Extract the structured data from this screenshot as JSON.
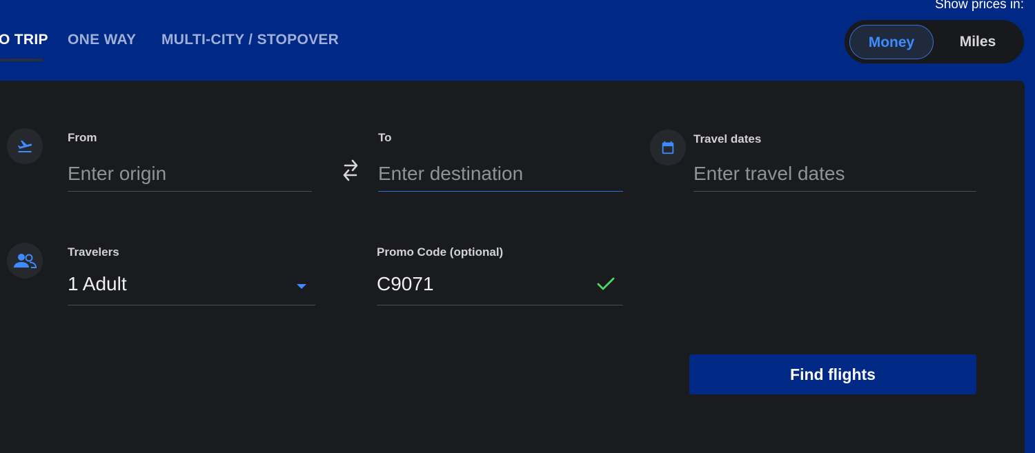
{
  "header": {
    "show_prices_label": "Show prices in:",
    "tabs": [
      {
        "label": "O TRIP",
        "active": true
      },
      {
        "label": "ONE WAY",
        "active": false
      },
      {
        "label": "MULTI-CITY / STOPOVER",
        "active": false
      }
    ],
    "price_toggle": {
      "options": [
        "Money",
        "Miles"
      ],
      "selected": "Money"
    }
  },
  "form": {
    "from": {
      "label": "From",
      "placeholder": "Enter origin",
      "value": "",
      "icon": "plane-departure-icon"
    },
    "swap_icon": "swap-arrows-icon",
    "to": {
      "label": "To",
      "placeholder": "Enter destination",
      "value": ""
    },
    "dates": {
      "label": "Travel dates",
      "placeholder": "Enter travel dates",
      "value": "",
      "icon": "calendar-icon"
    },
    "travelers": {
      "label": "Travelers",
      "value": "1 Adult",
      "icon": "people-icon"
    },
    "promo": {
      "label": "Promo Code (optional)",
      "value": "C9071",
      "valid_icon": "checkmark-icon"
    },
    "submit_label": "Find flights"
  },
  "colors": {
    "brand_blue": "#002885",
    "panel_bg": "#1a1b1e",
    "accent_blue": "#3d8bff",
    "valid_green": "#4cd964"
  }
}
